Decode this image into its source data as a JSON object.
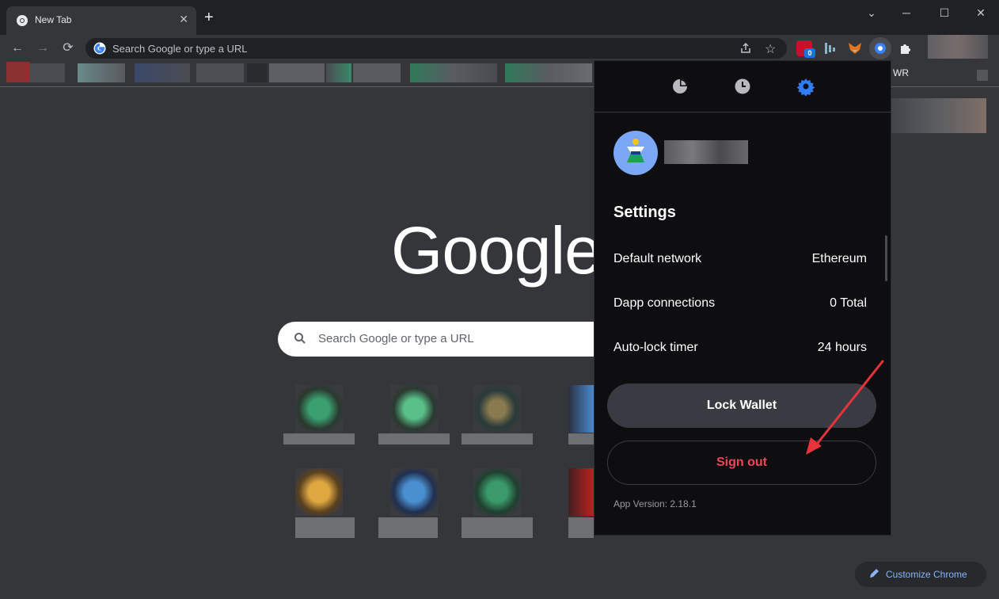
{
  "browser": {
    "tab_title": "New Tab",
    "tab_close": "✕",
    "new_tab": "+",
    "window_controls": {
      "minimize": "─",
      "maximize": "☐",
      "close": "✕",
      "tab_search": "⌄"
    },
    "nav": {
      "back": "←",
      "forward": "→",
      "reload": "⟳"
    },
    "omnibox_placeholder": "Search Google or type a URL",
    "extension_badge": "0",
    "bookmark_bar_visible_text": "WR"
  },
  "new_tab_page": {
    "logo_text": "Google",
    "search_placeholder": "Search Google or type a URL",
    "customize_label": "Customize Chrome"
  },
  "wallet_popup": {
    "tabs": [
      {
        "icon": "pie-chart-icon"
      },
      {
        "icon": "clock-icon"
      },
      {
        "icon": "gear-icon",
        "active": true
      }
    ],
    "settings_title": "Settings",
    "settings": [
      {
        "label": "Default network",
        "value": "Ethereum"
      },
      {
        "label": "Dapp connections",
        "value": "0 Total"
      },
      {
        "label": "Auto-lock timer",
        "value": "24 hours"
      }
    ],
    "lock_button": "Lock Wallet",
    "signout_button": "Sign out",
    "app_version": "App Version: 2.18.1"
  },
  "colors": {
    "accent_blue": "#1a73e8",
    "signout_red": "#f0455a",
    "arrow_red": "#e8333c"
  }
}
